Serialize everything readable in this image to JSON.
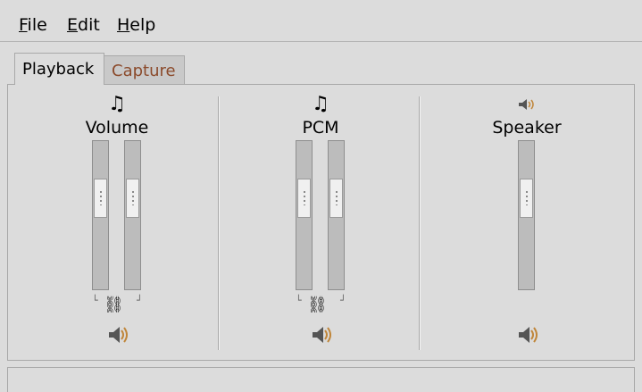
{
  "menu": {
    "file": {
      "label": "File",
      "mnemonic": "F",
      "rest": "ile"
    },
    "edit": {
      "label": "Edit",
      "mnemonic": "E",
      "rest": "dit"
    },
    "help": {
      "label": "Help",
      "mnemonic": "H",
      "rest": "elp"
    }
  },
  "tabs": [
    {
      "label": "Playback",
      "active": true
    },
    {
      "label": "Capture",
      "active": false
    }
  ],
  "channels": [
    {
      "name": "Volume",
      "icon": "music-note-icon",
      "sliders": 2,
      "locked": true,
      "level": 0.75
    },
    {
      "name": "PCM",
      "icon": "music-note-icon",
      "sliders": 2,
      "locked": true,
      "level": 0.75
    },
    {
      "name": "Speaker",
      "icon": "speaker-icon",
      "sliders": 1,
      "locked": false,
      "level": 0.75
    }
  ],
  "colors": {
    "background": "#dcdcdc",
    "inactive_tab_text": "#8b4a2b",
    "speaker_accent": "#c0863a"
  }
}
